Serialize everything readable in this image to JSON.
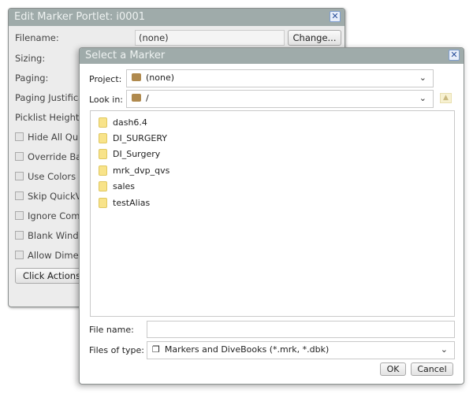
{
  "back_dialog": {
    "title": "Edit Marker Portlet: i0001",
    "filename_label": "Filename:",
    "filename_value": "(none)",
    "change_button": "Change...",
    "labels": [
      "Sizing:",
      "Paging:",
      "Paging Justifica",
      "Picklist Height:"
    ],
    "checkboxes": [
      "Hide All Quic",
      "Override Bac",
      "Use Colors S",
      "Skip QuickVi",
      "Ignore Comm",
      "Blank Windo",
      "Allow Dimen"
    ],
    "click_actions": "Click Actions..."
  },
  "dialog": {
    "title": "Select a Marker",
    "project_label": "Project:",
    "project_value": "(none)",
    "lookin_label": "Look in:",
    "lookin_value": "/",
    "files": [
      "dash6.4",
      "DI_SURGERY",
      "DI_Surgery",
      "mrk_dvp_qvs",
      "sales",
      "testAlias"
    ],
    "filename_label": "File name:",
    "filename_value": "",
    "filetype_label": "Files of type:",
    "filetype_value": "Markers and DiveBooks (*.mrk, *.dbk)",
    "ok": "OK",
    "cancel": "Cancel"
  },
  "colors": {
    "titlebar": "#9fabaa",
    "folder": "#f8e38a"
  }
}
